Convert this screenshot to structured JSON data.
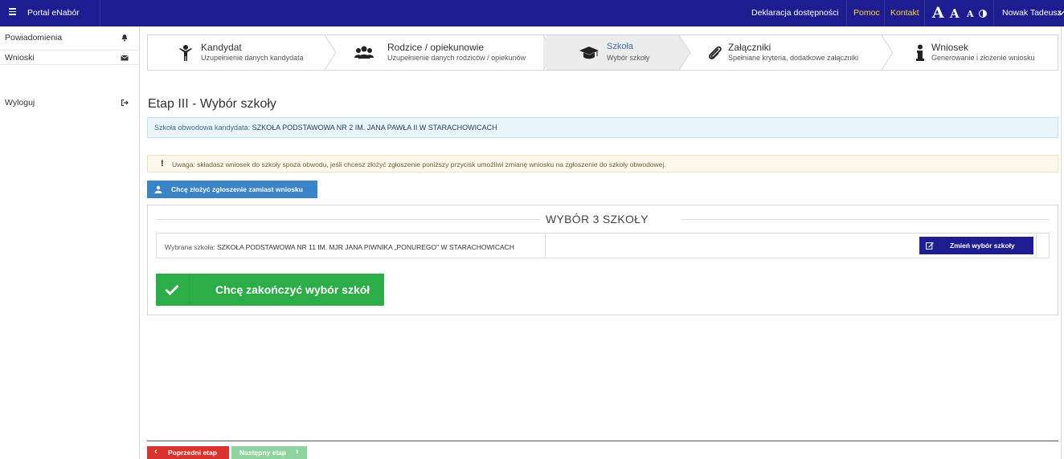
{
  "topbar": {
    "portal_title": "Portal eNabór",
    "accessibility_link": "Deklaracja dostępności",
    "help_link": "Pomoc",
    "contact_link": "Kontakt",
    "font_large": "A",
    "font_medium": "A",
    "font_small": "A",
    "user_name": "Nowak Tadeusz",
    "colors": {
      "background": "#1d1d8f",
      "highlight": "#ffd43b"
    }
  },
  "sidebar": {
    "items": [
      {
        "label": "Powiadomienia",
        "icon": "bell-icon"
      },
      {
        "label": "Wnioski",
        "icon": "envelope-icon"
      },
      {
        "label": "Wyloguj",
        "icon": "sign-out-icon"
      }
    ]
  },
  "steps": [
    {
      "title": "Kandydat",
      "subtitle": "Uzupełnienie danych kandydata",
      "icon": "child-icon"
    },
    {
      "title": "Rodzice / opiekunowie",
      "subtitle": "Uzupełnienie danych rodziców / opiekunów",
      "icon": "users-icon"
    },
    {
      "title": "Szkoła",
      "subtitle": "Wybór szkoły",
      "icon": "graduation-cap-icon",
      "active": true
    },
    {
      "title": "Załączniki",
      "subtitle": "Spełniane kryteria, dodatkowe załączniki",
      "icon": "paperclip-icon"
    },
    {
      "title": "Wniosek",
      "subtitle": "Generowanie i złożenie wniosku",
      "icon": "info-icon"
    }
  ],
  "main": {
    "page_title": "Etap III - Wybór szkoły",
    "district_prefix": "Szkoła obwodowa kandydata:",
    "district_school": "SZKOŁA PODSTAWOWA NR 2 IM. JANA PAWŁA II W STARACHOWICACH",
    "warning_mark": "!",
    "warning_text": "Uwaga: składasz wniosek do szkoły spoza obwodu, jeśli chcesz złożyć zgłoszenie poniższy przycisk umożliwi zmianę wniosku na zgłoszenie do szkoły obwodowej.",
    "switch_button": "Chcę złożyć zgłoszenie zamiast wniosku",
    "panel_heading": "WYBÓR 3 SZKOŁY",
    "selected_prefix": "Wybrana szkoła:",
    "selected_school": "SZKOŁA PODSTAWOWA NR 11 IM. MJR JANA PIWNIKA „PONUREGO\" W STARACHOWICACH",
    "change_button": "Zmień wybór szkoły",
    "finish_button": "Chcę zakończyć wybór szkół"
  },
  "footer": {
    "prev_button": "Poprzedni etap",
    "next_button": "Następny etap",
    "prev_arrow": "‹",
    "next_arrow": "›"
  }
}
